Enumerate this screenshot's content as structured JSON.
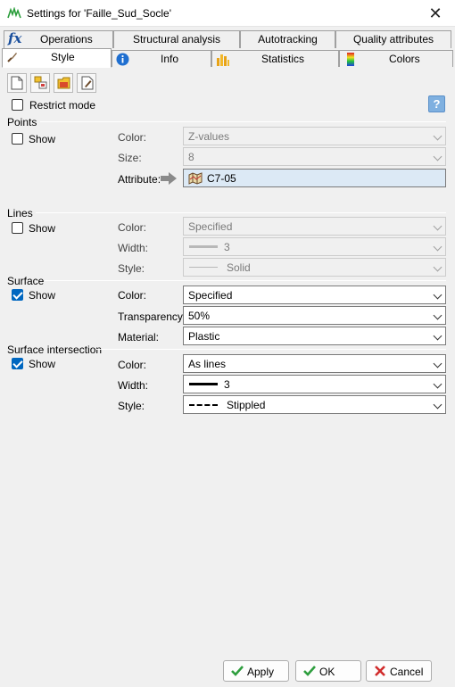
{
  "window": {
    "title": "Settings for 'Faille_Sud_Socle'",
    "close": "✕"
  },
  "tabs_row1": [
    {
      "label": "Operations",
      "icon": "fx-icon"
    },
    {
      "label": "Structural analysis"
    },
    {
      "label": "Autotracking"
    },
    {
      "label": "Quality attributes"
    }
  ],
  "tabs_row2": [
    {
      "label": "Style",
      "icon": "brush-icon",
      "active": true
    },
    {
      "label": "Info",
      "icon": "info-icon"
    },
    {
      "label": "Statistics",
      "icon": "bar-chart-icon"
    },
    {
      "label": "Colors",
      "icon": "color-scale-icon"
    }
  ],
  "restrict_mode": {
    "label": "Restrict mode",
    "checked": false
  },
  "help": {
    "label": "?"
  },
  "points": {
    "title": "Points",
    "show_label": "Show",
    "show_checked": false,
    "color_label": "Color:",
    "color_value": "Z-values",
    "size_label": "Size:",
    "size_value": "8",
    "attribute_label": "Attribute:",
    "attribute_value": "C7-05"
  },
  "lines": {
    "title": "Lines",
    "show_label": "Show",
    "show_checked": false,
    "color_label": "Color:",
    "color_value": "Specified",
    "width_label": "Width:",
    "width_value": "3",
    "style_label": "Style:",
    "style_value": "Solid"
  },
  "surface": {
    "title": "Surface",
    "show_label": "Show",
    "show_checked": true,
    "color_label": "Color:",
    "color_value": "Specified",
    "transparency_label": "Transparency:",
    "transparency_value": "50%",
    "material_label": "Material:",
    "material_value": "Plastic"
  },
  "intersection": {
    "title": "Surface intersection",
    "show_label": "Show",
    "show_checked": true,
    "color_label": "Color:",
    "color_value": "As lines",
    "width_label": "Width:",
    "width_value": "3",
    "style_label": "Style:",
    "style_value": "Stippled"
  },
  "buttons": {
    "apply": "Apply",
    "ok": "OK",
    "cancel": "Cancel"
  },
  "colors": {
    "accent": "#0067c0",
    "ok_green": "#2e9e3e",
    "cancel_red": "#d12b2b"
  }
}
